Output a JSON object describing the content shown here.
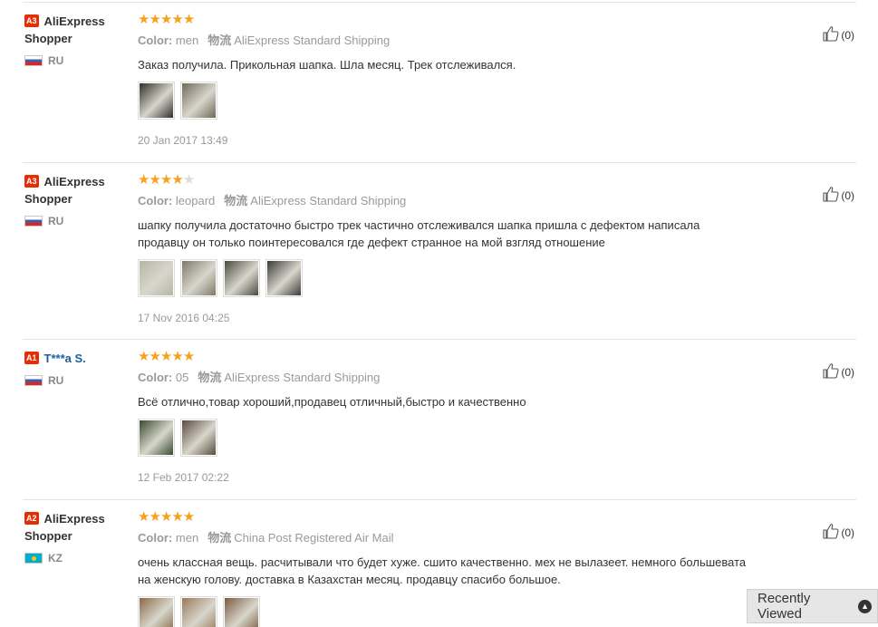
{
  "reviews": [
    {
      "badge": "A3",
      "user": "AliExpress Shopper",
      "country": "RU",
      "flag": "ru",
      "rating": 5,
      "color_label": "Color:",
      "color_value": "men",
      "ship_label": "物流",
      "ship_value": "AliExpress Standard Shipping",
      "text": "Заказ получила. Прикольная шапка. Шла месяц. Трек отслеживался.",
      "photos": [
        {
          "bg": "#2e2f29"
        },
        {
          "bg": "#6f6a58"
        }
      ],
      "date": "20 Jan 2017 13:49",
      "helpful": "(0)"
    },
    {
      "badge": "A3",
      "user": "AliExpress Shopper",
      "country": "RU",
      "flag": "ru",
      "rating": 4,
      "color_label": "Color:",
      "color_value": "leopard",
      "ship_label": "物流",
      "ship_value": "AliExpress Standard Shipping",
      "text": "шапку получила достаточно быстро трек частично отслеживался шапка пришла с дефектом написала продавцу он только поинтересовался где дефект странное на мой взгляд отношение",
      "photos": [
        {
          "bg": "#b7b6a4"
        },
        {
          "bg": "#7d7a6a"
        },
        {
          "bg": "#4a4a3f"
        },
        {
          "bg": "#3a3a37"
        }
      ],
      "date": "17 Nov 2016 04:25",
      "helpful": "(0)"
    },
    {
      "badge": "A1",
      "user": "T***a S.",
      "country": "RU",
      "flag": "ru",
      "rating": 5,
      "color_label": "Color:",
      "color_value": "05",
      "ship_label": "物流",
      "ship_value": "AliExpress Standard Shipping",
      "text": "Всё отлично,товар хороший,продавец отличный,быстро и качественно",
      "photos": [
        {
          "bg": "#3a4a2f"
        },
        {
          "bg": "#5a4a3f"
        }
      ],
      "date": "12 Feb 2017 02:22",
      "helpful": "(0)"
    },
    {
      "badge": "A2",
      "user": "AliExpress Shopper",
      "country": "KZ",
      "flag": "kz",
      "rating": 5,
      "color_label": "Color:",
      "color_value": "men",
      "ship_label": "物流",
      "ship_value": "China Post Registered Air Mail",
      "text": "очень классная вещь. расчитывали что будет хуже. сшито качественно. мех не вылазеет. немного большевата на женскую голову. доставка в Казахстан месяц. продавцу спасибо большое.",
      "photos": [
        {
          "bg": "#8a6a48"
        },
        {
          "bg": "#9a7a58"
        },
        {
          "bg": "#7a5a40"
        }
      ],
      "date": "",
      "helpful": "(0)"
    }
  ],
  "recently_viewed": {
    "label": "Recently Viewed",
    "icon": "chevron-up-icon"
  },
  "colors": {
    "star": "#f7a21f",
    "badge": "#e62e04",
    "link": "#1b5f9e"
  }
}
